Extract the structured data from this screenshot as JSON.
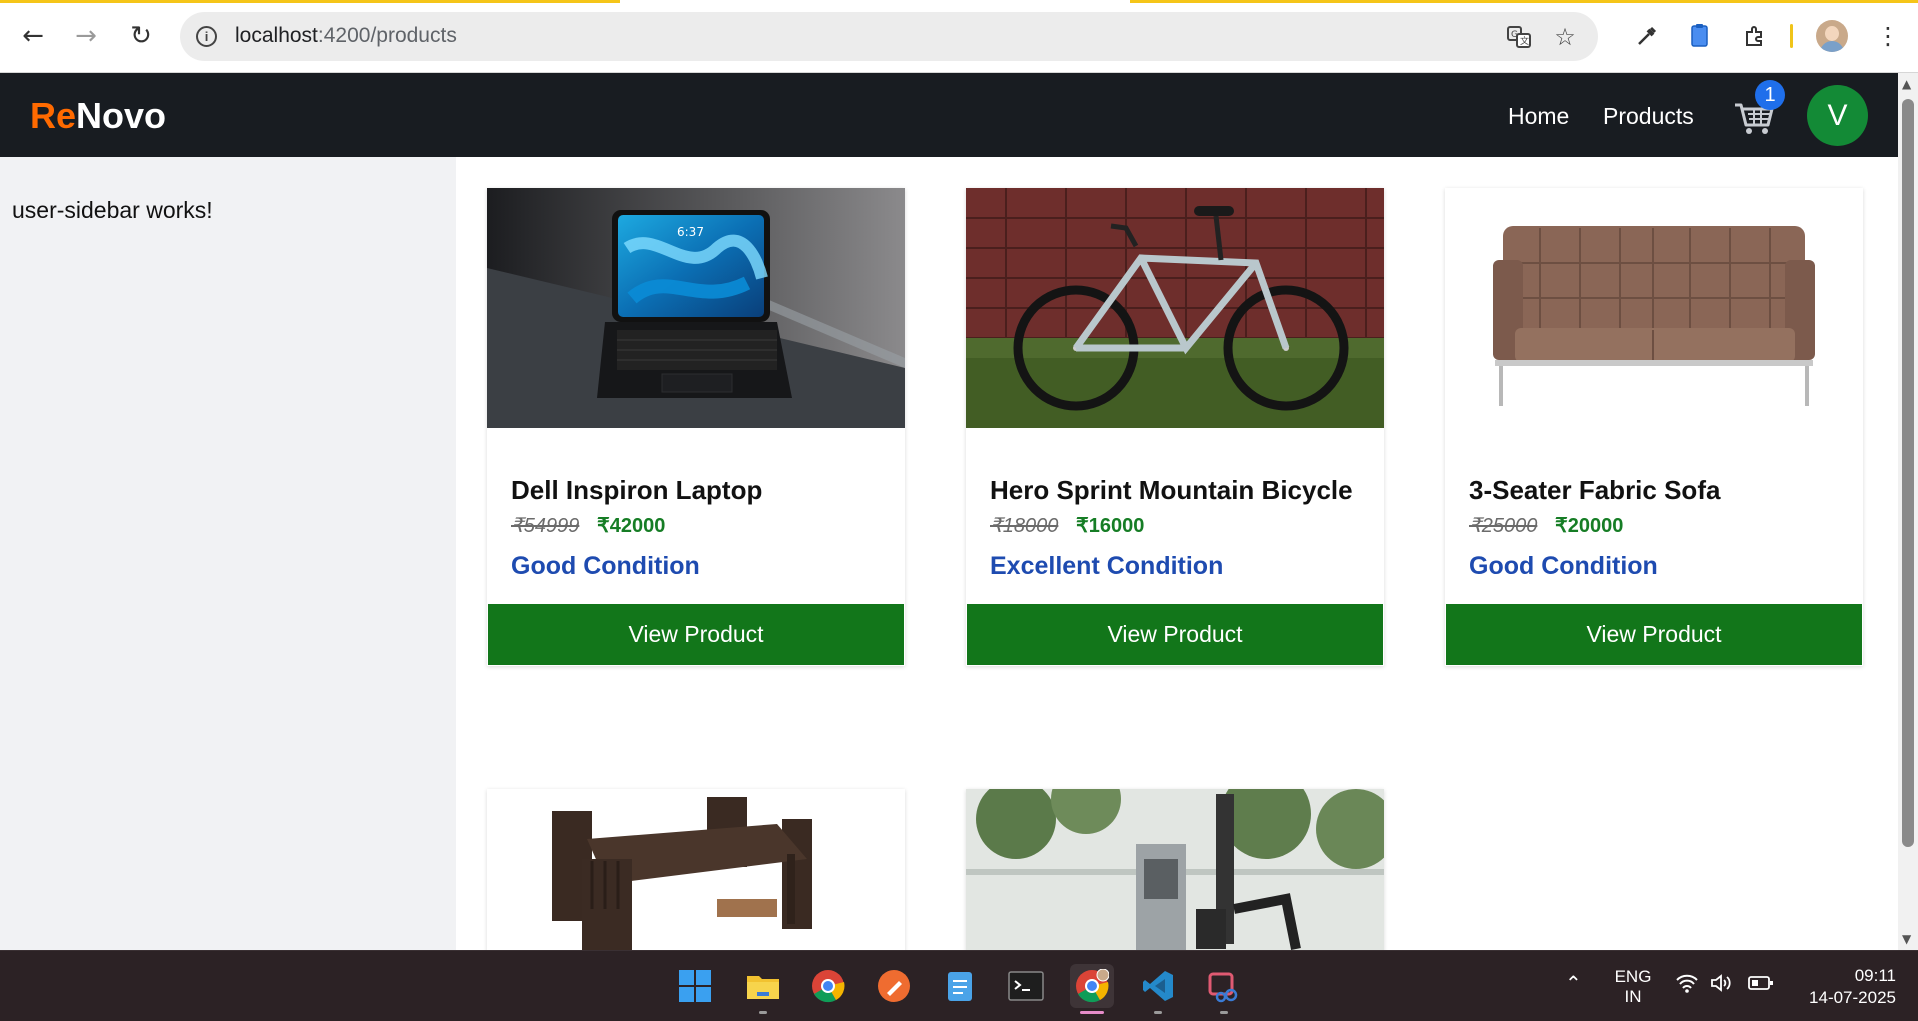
{
  "browser": {
    "url_host": "localhost",
    "url_path": ":4200/products"
  },
  "navbar": {
    "brand_accent": "Re",
    "brand_rest": "Novo",
    "links": [
      {
        "label": "Home"
      },
      {
        "label": "Products"
      }
    ],
    "cart_count": "1",
    "user_initial": "V"
  },
  "sidebar": {
    "text": "user-sidebar works!"
  },
  "products": [
    {
      "title": "Dell Inspiron Laptop",
      "old_price": "₹54999",
      "new_price": "₹42000",
      "condition": "Good Condition",
      "button": "View Product",
      "image": "laptop-image"
    },
    {
      "title": "Hero Sprint Mountain Bicycle",
      "old_price": "₹18000",
      "new_price": "₹16000",
      "condition": "Excellent Condition",
      "button": "View Product",
      "image": "bicycle-image"
    },
    {
      "title": "3-Seater Fabric Sofa",
      "old_price": "₹25000",
      "new_price": "₹20000",
      "condition": "Good Condition",
      "button": "View Product",
      "image": "sofa-image"
    },
    {
      "image": "dining-table-image"
    },
    {
      "image": "gym-equipment-image"
    }
  ],
  "taskbar": {
    "lang_line1": "ENG",
    "lang_line2": "IN",
    "time": "09:11",
    "date": "14-07-2025"
  },
  "colors": {
    "navbar_bg": "#181c21",
    "brand_accent": "#ff6a00",
    "button_green": "#12761a",
    "price_green": "#167d25",
    "condition_blue": "#1e4bb0",
    "avatar_green": "#138a36",
    "badge_blue": "#1f6feb"
  }
}
